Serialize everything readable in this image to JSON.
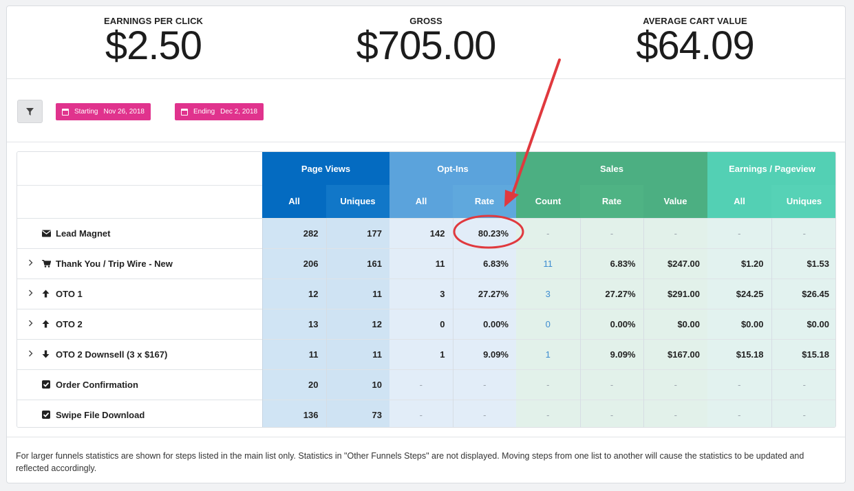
{
  "stats": {
    "earnings_per_click": {
      "label": "EARNINGS PER CLICK",
      "value": "$2.50"
    },
    "gross": {
      "label": "GROSS",
      "value": "$705.00"
    },
    "average_cart_value": {
      "label": "AVERAGE CART VALUE",
      "value": "$64.09"
    }
  },
  "filters": {
    "filter_icon": "filter-icon",
    "starting": {
      "label": "Starting",
      "date": "Nov 26, 2018"
    },
    "ending": {
      "label": "Ending",
      "date": "Dec 2, 2018"
    }
  },
  "table": {
    "groups": {
      "page_views": "Page Views",
      "opt_ins": "Opt-Ins",
      "sales": "Sales",
      "earnings": "Earnings / Pageview"
    },
    "subheaders": {
      "pv_all": "All",
      "pv_uniques": "Uniques",
      "oi_all": "All",
      "oi_rate": "Rate",
      "s_count": "Count",
      "s_rate": "Rate",
      "s_value": "Value",
      "e_all": "All",
      "e_uniques": "Uniques"
    },
    "rows": [
      {
        "expandable": false,
        "icon": "envelope-icon",
        "name": "Lead Magnet",
        "pv_all": "282",
        "pv_uniques": "177",
        "oi_all": "142",
        "oi_rate": "80.23%",
        "s_count": "-",
        "s_rate": "-",
        "s_value": "-",
        "e_all": "-",
        "e_uniques": "-"
      },
      {
        "expandable": true,
        "icon": "cart-icon",
        "name": "Thank You / Trip Wire - New",
        "pv_all": "206",
        "pv_uniques": "161",
        "oi_all": "11",
        "oi_rate": "6.83%",
        "s_count": "11",
        "s_rate": "6.83%",
        "s_value": "$247.00",
        "e_all": "$1.20",
        "e_uniques": "$1.53"
      },
      {
        "expandable": true,
        "icon": "arrow-up-icon",
        "name": "OTO 1",
        "pv_all": "12",
        "pv_uniques": "11",
        "oi_all": "3",
        "oi_rate": "27.27%",
        "s_count": "3",
        "s_rate": "27.27%",
        "s_value": "$291.00",
        "e_all": "$24.25",
        "e_uniques": "$26.45"
      },
      {
        "expandable": true,
        "icon": "arrow-up-icon",
        "name": "OTO 2",
        "pv_all": "13",
        "pv_uniques": "12",
        "oi_all": "0",
        "oi_rate": "0.00%",
        "s_count": "0",
        "s_rate": "0.00%",
        "s_value": "$0.00",
        "e_all": "$0.00",
        "e_uniques": "$0.00"
      },
      {
        "expandable": true,
        "icon": "arrow-down-icon",
        "name": "OTO 2 Downsell (3 x $167)",
        "pv_all": "11",
        "pv_uniques": "11",
        "oi_all": "1",
        "oi_rate": "9.09%",
        "s_count": "1",
        "s_rate": "9.09%",
        "s_value": "$167.00",
        "e_all": "$15.18",
        "e_uniques": "$15.18"
      },
      {
        "expandable": false,
        "icon": "checkbox-icon",
        "name": "Order Confirmation",
        "pv_all": "20",
        "pv_uniques": "10",
        "oi_all": "-",
        "oi_rate": "-",
        "s_count": "-",
        "s_rate": "-",
        "s_value": "-",
        "e_all": "-",
        "e_uniques": "-"
      },
      {
        "expandable": false,
        "icon": "checkbox-icon",
        "name": "Swipe File Download",
        "pv_all": "136",
        "pv_uniques": "73",
        "oi_all": "-",
        "oi_rate": "-",
        "s_count": "-",
        "s_rate": "-",
        "s_value": "-",
        "e_all": "-",
        "e_uniques": "-"
      }
    ]
  },
  "footer": {
    "note": "For larger funnels statistics are shown for steps listed in the main list only. Statistics in \"Other Funnels Steps\" are not displayed. Moving steps from one list to another will cause the statistics to be updated and reflected accordingly."
  },
  "colors": {
    "page_views": "#046bc1",
    "opt_ins": "#5ba3dc",
    "sales": "#4caf82",
    "earnings": "#53d0b4",
    "date_tag": "#e0338d",
    "annotation": "#e0393e",
    "link": "#3d8cd0"
  }
}
